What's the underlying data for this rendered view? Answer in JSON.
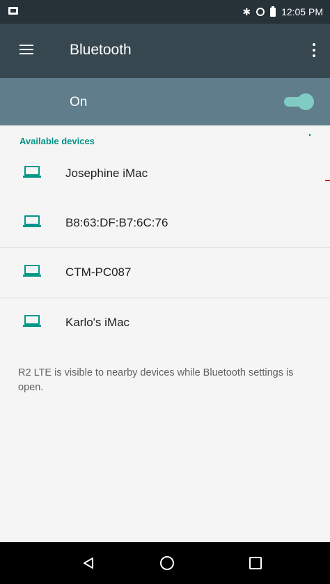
{
  "status_bar": {
    "time": "12:05 PM",
    "bluetooth_symbol": "✱",
    "icons": [
      "notification-icon",
      "bluetooth-icon",
      "sync-icon",
      "battery-icon"
    ]
  },
  "app_bar": {
    "title": "Bluetooth",
    "icons": [
      "menu-icon",
      "more-vert-icon"
    ]
  },
  "master_switch": {
    "label": "On",
    "state": true
  },
  "section_header": "Available devices",
  "devices": [
    {
      "name": "Josephine iMac",
      "icon": "laptop-icon"
    },
    {
      "name": "B8:63:DF:B7:6C:76",
      "icon": "laptop-icon"
    },
    {
      "name": "CTM-PC087",
      "icon": "laptop-icon"
    },
    {
      "name": "Karlo's iMac",
      "icon": "laptop-icon"
    }
  ],
  "footer": "R2 LTE is visible to nearby devices while Bluetooth settings is open.",
  "nav_bar": {
    "icons": [
      "back-icon",
      "home-icon",
      "recents-icon"
    ]
  },
  "colors": {
    "status_bar": "#263238",
    "app_bar": "#37474f",
    "switch_bar": "#607d8b",
    "accent": "#009688",
    "toggle": "#80cbc4",
    "background": "#f5f5f5"
  }
}
